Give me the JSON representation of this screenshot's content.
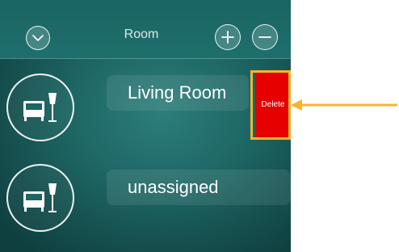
{
  "header": {
    "title": "Room",
    "collapse_icon": "chevron-down-icon",
    "add_icon": "plus-icon",
    "remove_icon": "minus-icon"
  },
  "rooms": [
    {
      "name": "Living Room",
      "icon": "sofa-lamp-icon"
    },
    {
      "name": "unassigned",
      "icon": "sofa-lamp-icon"
    }
  ],
  "delete_button": {
    "label": "Delete",
    "color": "#e60000"
  },
  "annotation": {
    "highlight_color": "#f5b52e",
    "arrow_color": "#f5b52e"
  },
  "colors": {
    "background": "#1d6563",
    "header": "#1e6f6c"
  }
}
